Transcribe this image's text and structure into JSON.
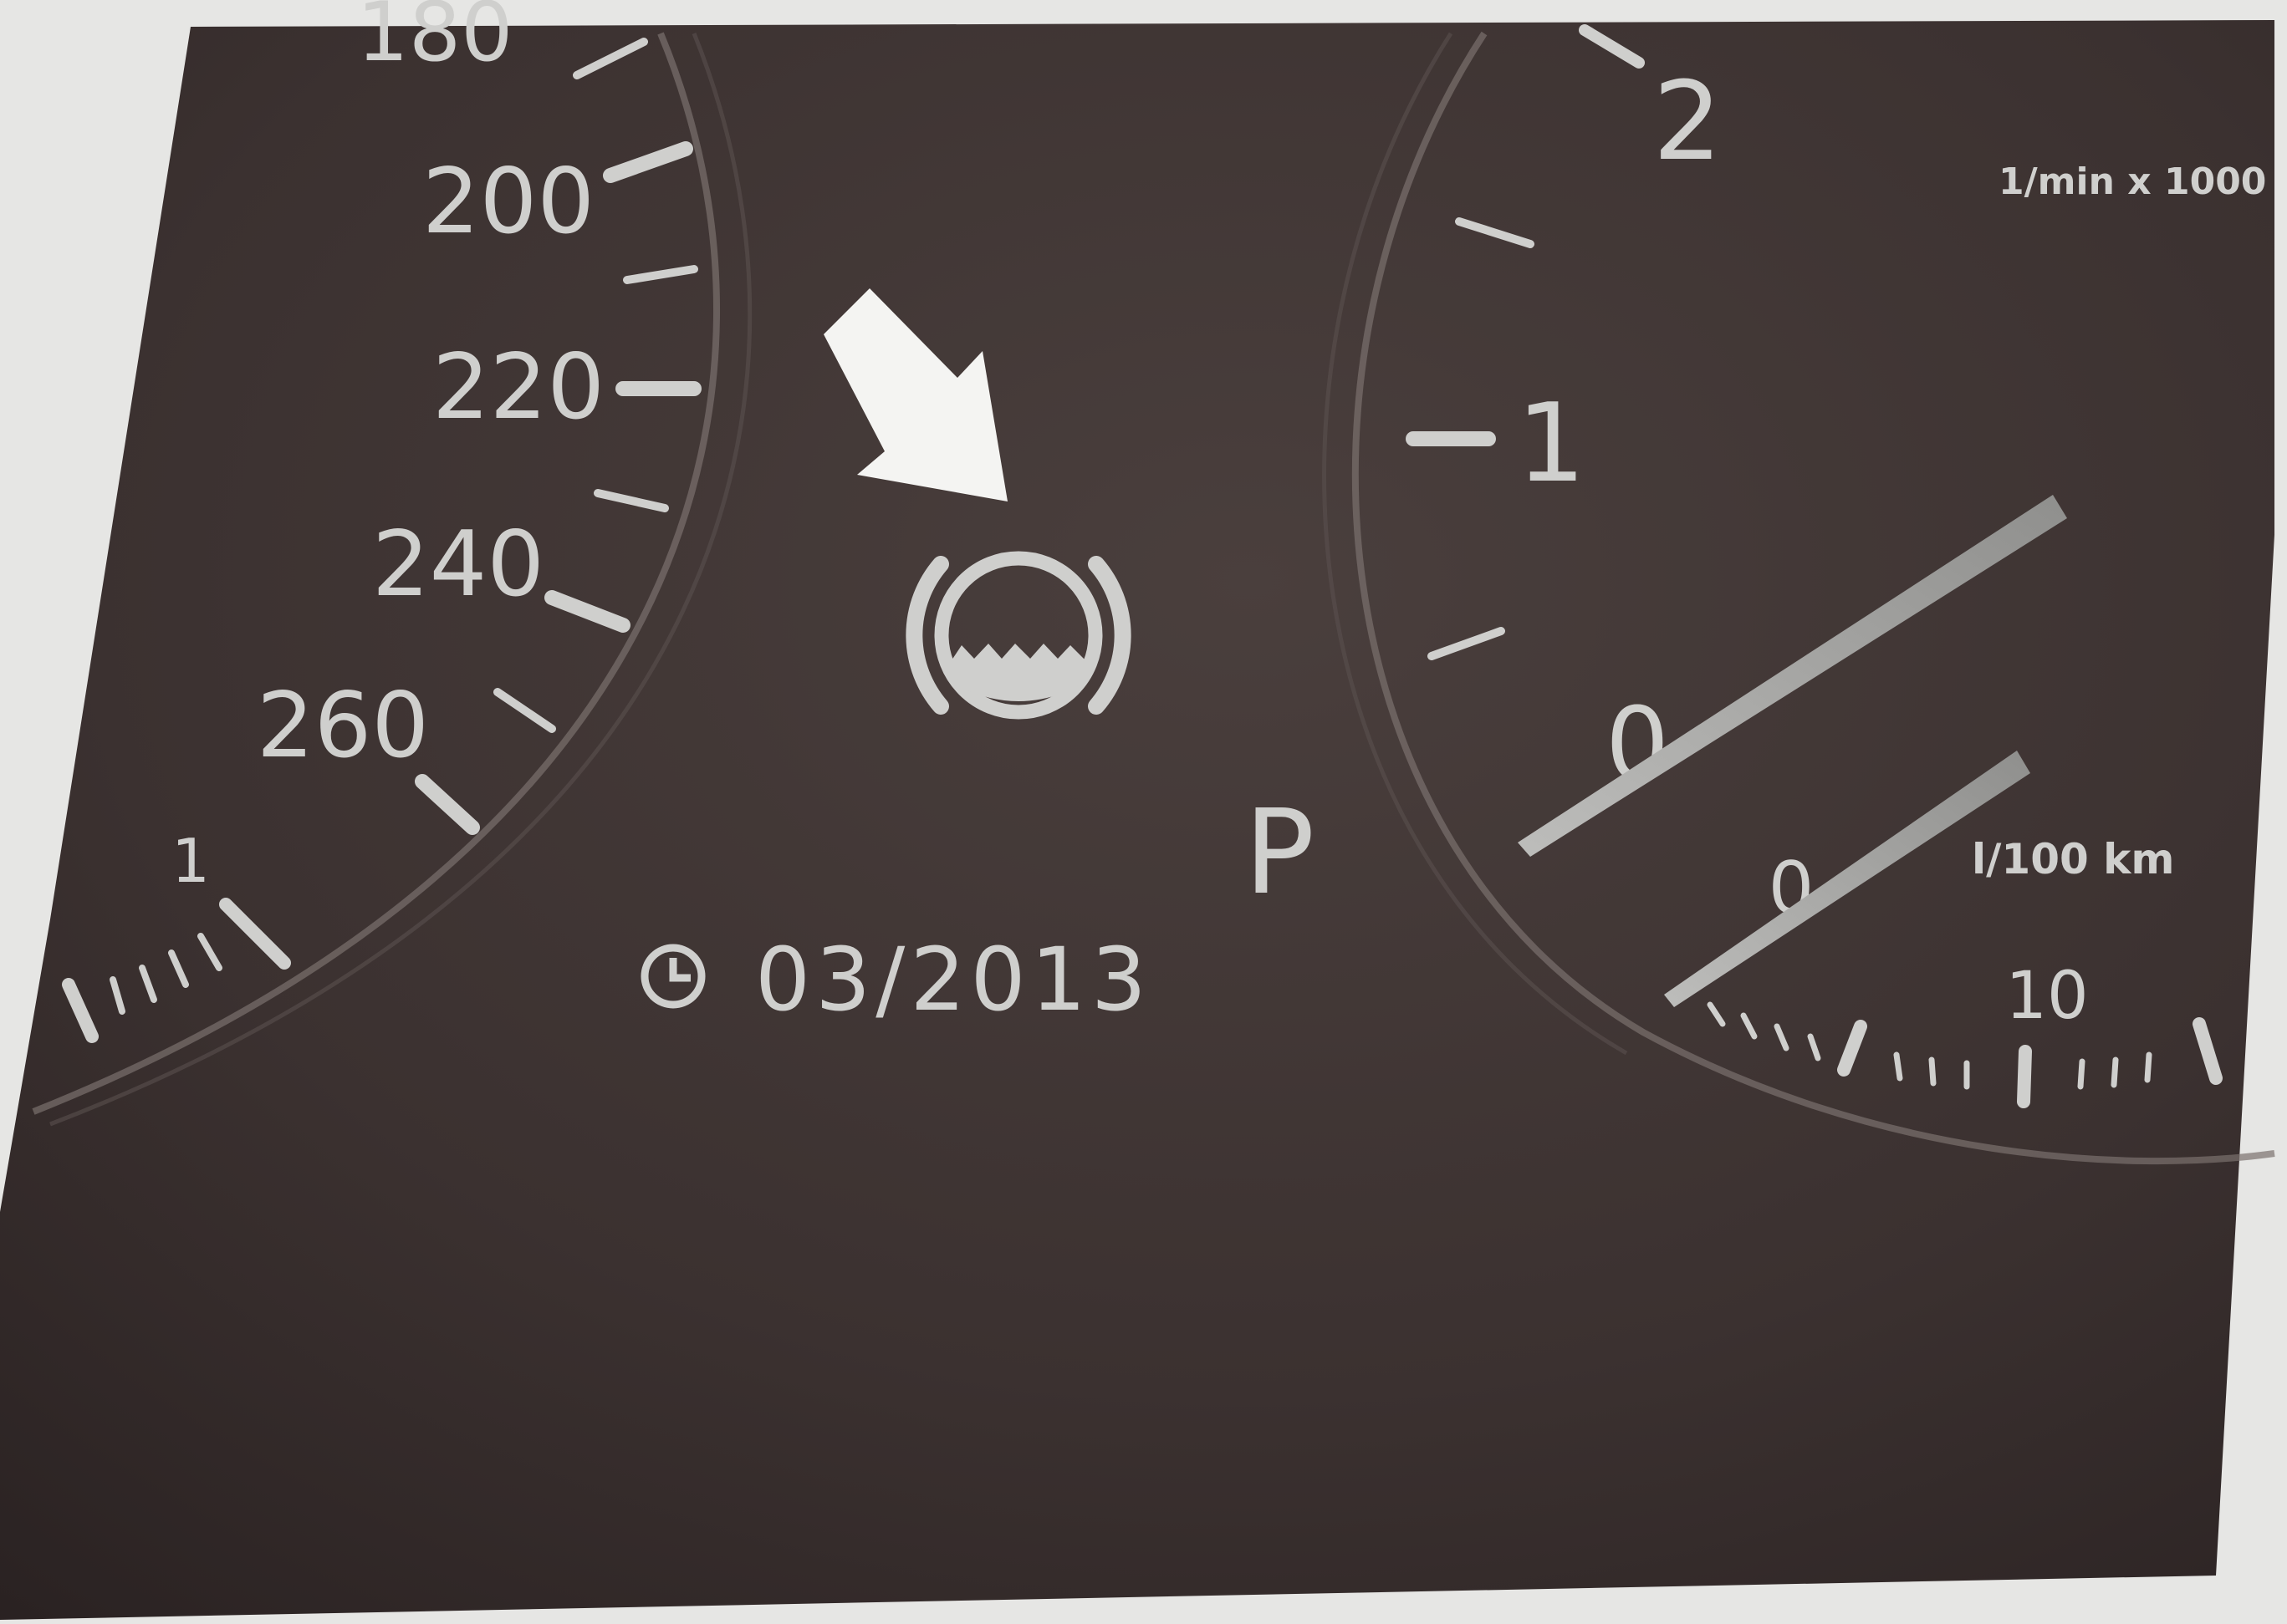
{
  "speedometer": {
    "labels": [
      "180",
      "200",
      "220",
      "240",
      "260"
    ],
    "sub_scale_label": "1"
  },
  "tachometer": {
    "labels": [
      "2",
      "1",
      "0"
    ],
    "unit": "1/min x 1000"
  },
  "fuel_consumption": {
    "labels": [
      "0",
      "10"
    ],
    "unit": "l/100 km"
  },
  "indicators": {
    "gear": "P",
    "warning_icon": "brake-pad-wear-icon",
    "pointer_arrow": "arrow-icon"
  },
  "service": {
    "icon": "clock-icon",
    "date": "03/2013"
  },
  "colors": {
    "background": "#e6e6e4",
    "panel": "#3b3130",
    "markings": "#cfcfcd"
  }
}
